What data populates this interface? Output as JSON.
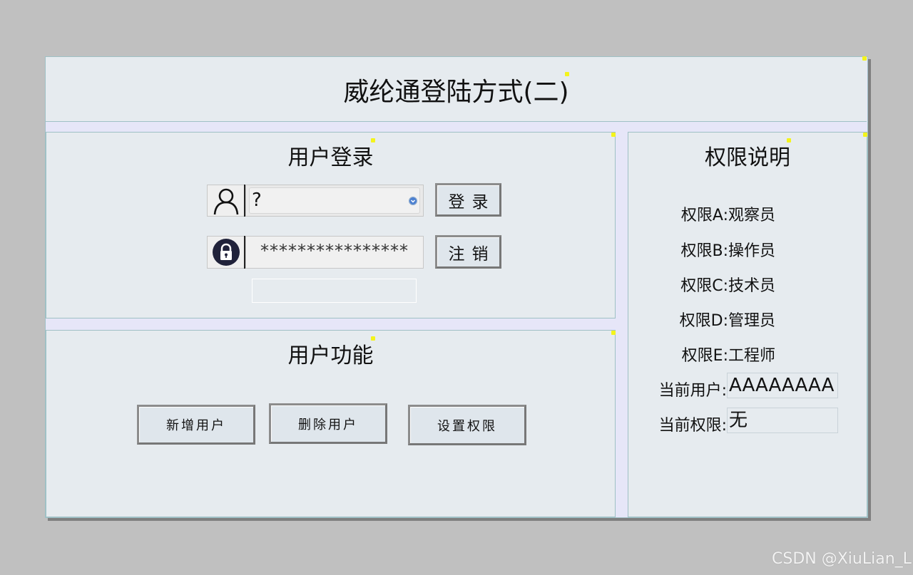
{
  "header": {
    "title": "威纶通登陆方式(二)"
  },
  "login_panel": {
    "title": "用户登录",
    "username_value": "?",
    "password_value": "****************",
    "login_button": "登录",
    "logout_button": "注销"
  },
  "function_panel": {
    "title": "用户功能",
    "buttons": [
      "新增用户",
      "删除用户",
      "设置权限"
    ]
  },
  "rights_panel": {
    "title": "权限说明",
    "roles": [
      {
        "label": "权限A:",
        "value": "观察员"
      },
      {
        "label": "权限B:",
        "value": "操作员"
      },
      {
        "label": "权限C:",
        "value": "技术员"
      },
      {
        "label": "权限D:",
        "value": "管理员"
      },
      {
        "label": "权限E:",
        "value": "工程师"
      }
    ],
    "current_user_label": "当前用户:",
    "current_user_value": "AAAAAAAA",
    "current_right_label": "当前权限:",
    "current_right_value": "无"
  },
  "watermark": "CSDN @XiuLian_L",
  "icons": [
    "user-icon",
    "lock-icon",
    "dropdown-icon"
  ]
}
